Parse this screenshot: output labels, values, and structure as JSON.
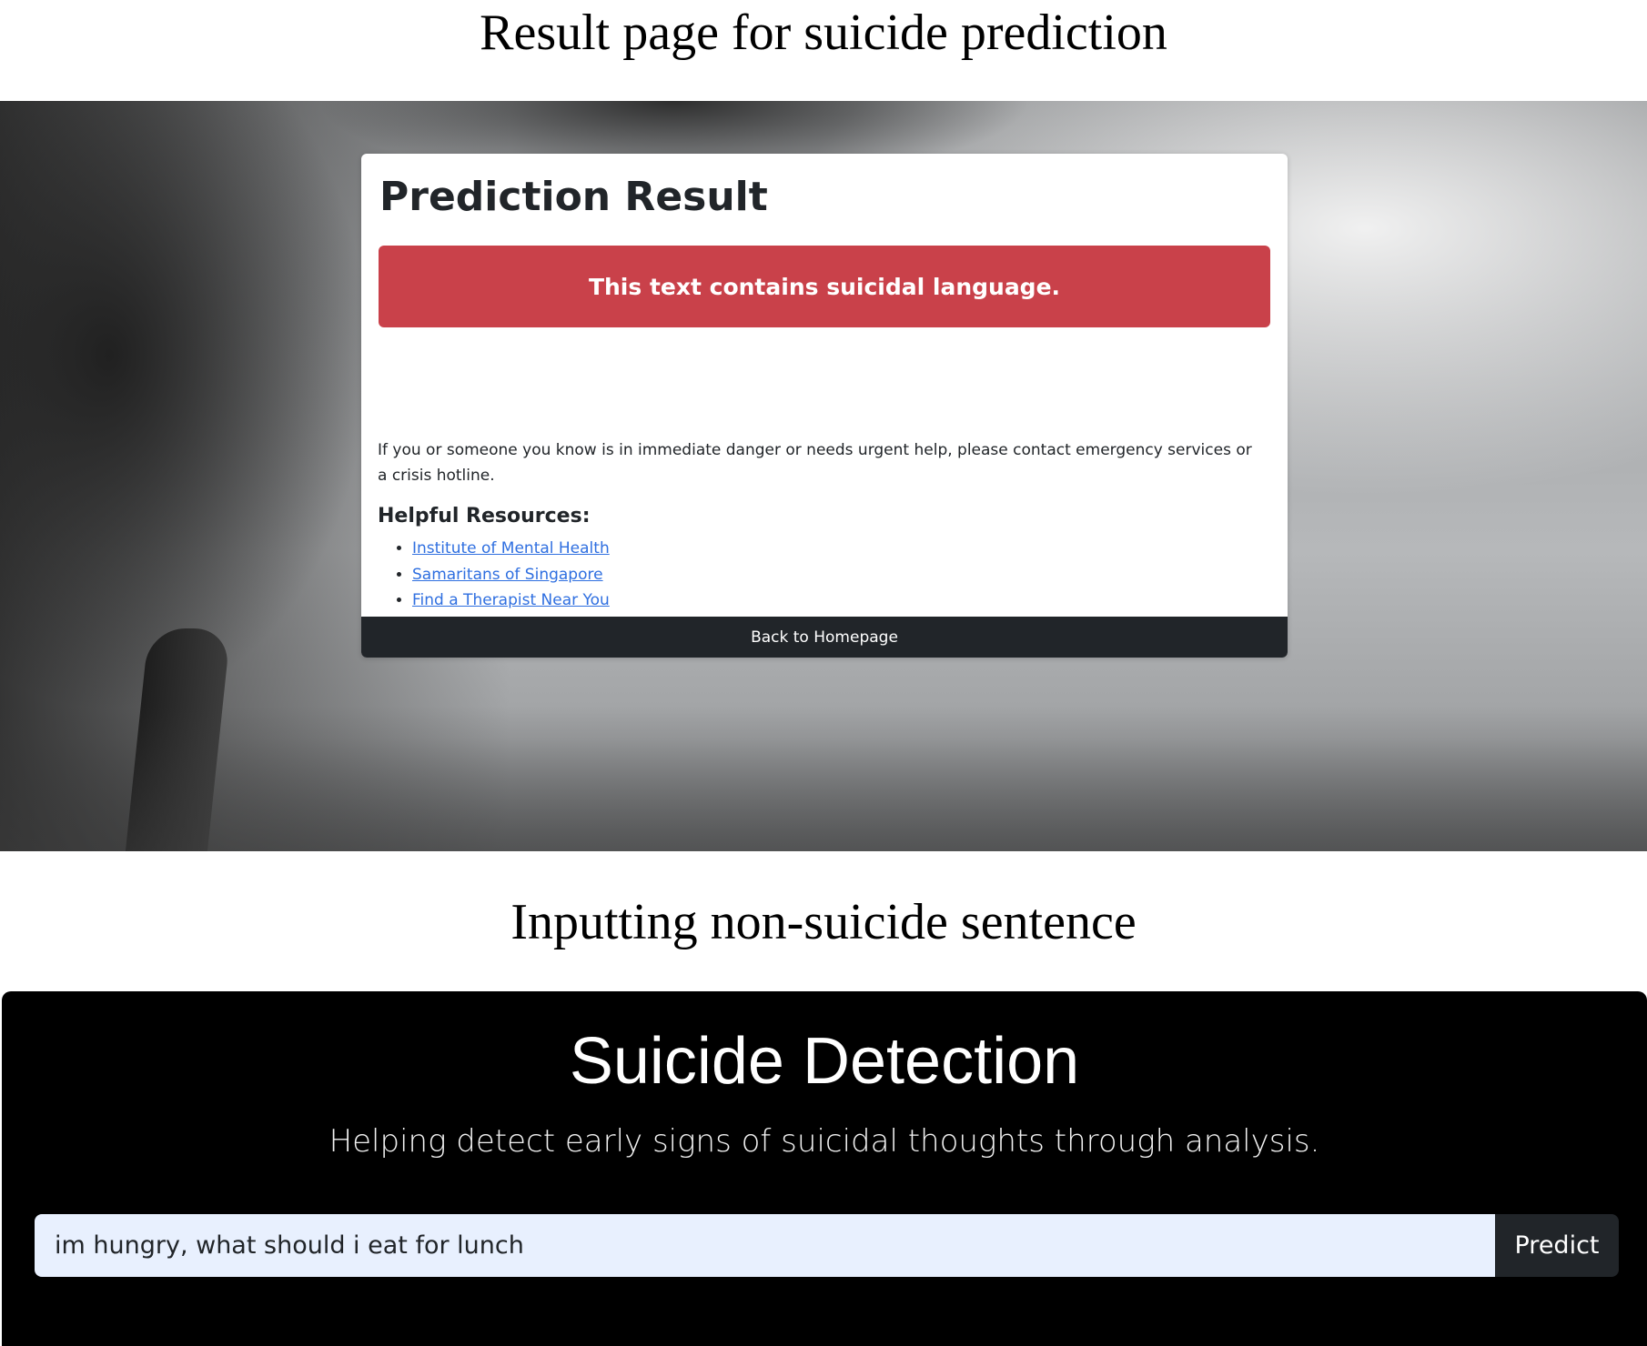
{
  "captions": {
    "top": "Result page for suicide prediction",
    "bottom": "Inputting non-suicide sentence"
  },
  "result_page": {
    "heading": "Prediction Result",
    "alert_text": "This text contains suicidal language.",
    "help_text": "If you or someone you know is in immediate danger or needs urgent help, please contact emergency services or a crisis hotline.",
    "resources_heading": "Helpful Resources:",
    "resources": [
      {
        "label": "Institute of Mental Health"
      },
      {
        "label": "Samaritans of Singapore"
      },
      {
        "label": "Find a Therapist Near You"
      }
    ],
    "back_button": "Back to Homepage",
    "colors": {
      "alert_bg": "#c9414a",
      "button_bg": "#212529",
      "link": "#2f6fe0"
    }
  },
  "input_page": {
    "title": "Suicide Detection",
    "subtitle": "Helping detect early signs of suicidal thoughts through analysis.",
    "input_value": "im hungry, what should i eat for lunch",
    "predict_button": "Predict",
    "colors": {
      "background": "#000000",
      "input_bg": "#e8f0fe",
      "button_bg": "#212529"
    }
  }
}
